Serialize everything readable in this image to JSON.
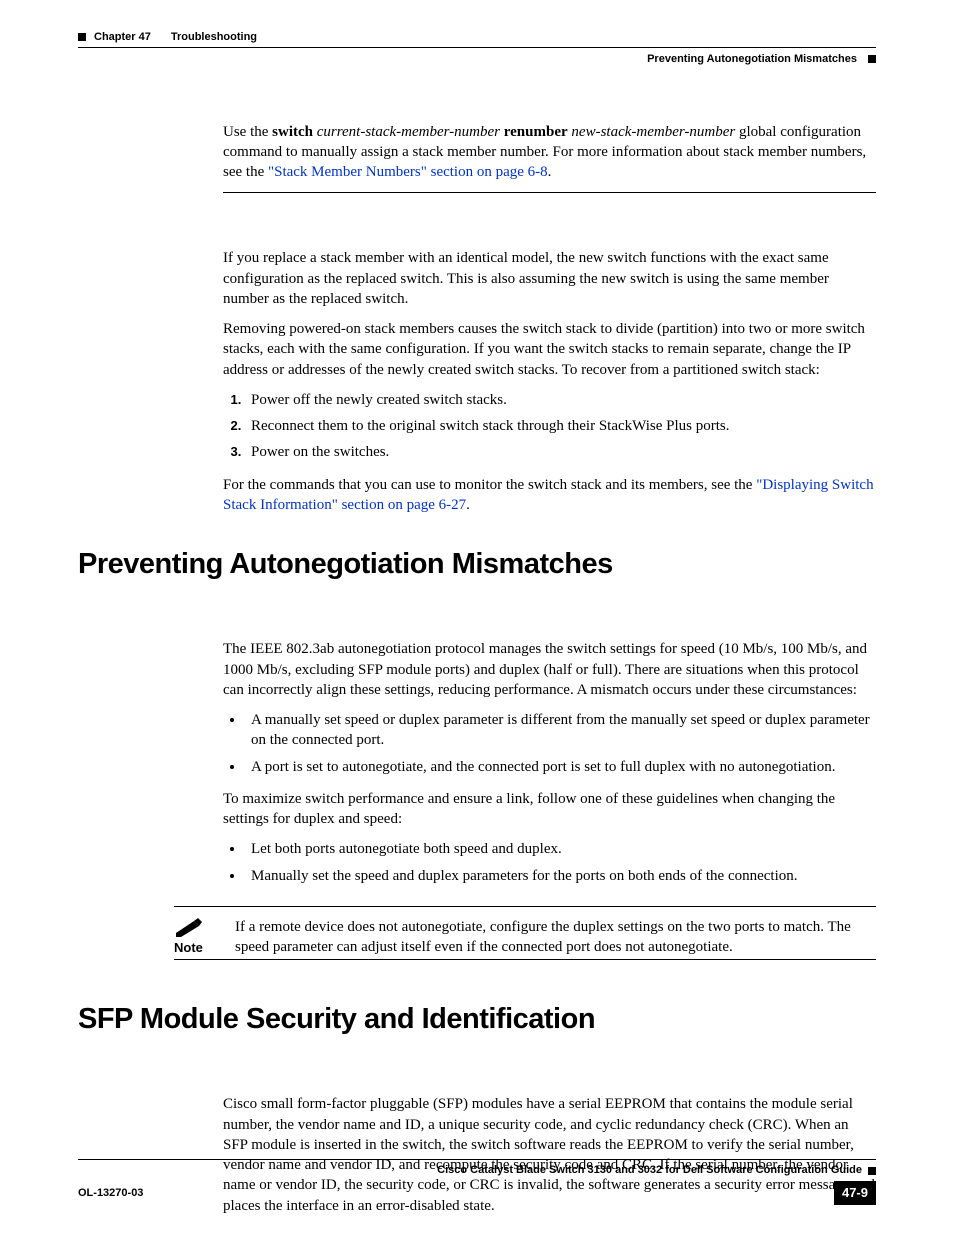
{
  "header": {
    "chapter_label": "Chapter 47",
    "chapter_title": "Troubleshooting",
    "section_right": "Preventing Autonegotiation Mismatches"
  },
  "intro": {
    "prefix": "Use the ",
    "cmd1": "switch",
    "arg1": " current-stack-member-number ",
    "cmd2": "renumber",
    "arg2": " new-stack-member-number",
    "suffix": " global configuration command to manually assign a stack member number. For more information about stack member numbers, see the ",
    "link1": "\"Stack Member Numbers\" section on page 6-8",
    "end": "."
  },
  "para2": "If you replace a stack member with an identical model, the new switch functions with the exact same configuration as the replaced switch. This is also assuming the new switch is using the same member number as the replaced switch.",
  "para3": "Removing powered-on stack members causes the switch stack to divide (partition) into two or more switch stacks, each with the same configuration. If you want the switch stacks to remain separate, change the IP address or addresses of the newly created switch stacks. To recover from a partitioned switch stack:",
  "steps": [
    "Power off the newly created switch stacks.",
    "Reconnect them to the original switch stack through their StackWise Plus ports.",
    "Power on the switches."
  ],
  "para4_prefix": "For the commands that you can use to monitor the switch stack and its members, see the ",
  "para4_link": "\"Displaying Switch Stack Information\" section on page 6-27",
  "para4_end": ".",
  "section1": {
    "title": "Preventing Autonegotiation Mismatches",
    "p1": "The IEEE 802.3ab autonegotiation protocol manages the switch settings for speed (10 Mb/s, 100 Mb/s, and 1000 Mb/s, excluding SFP module ports) and duplex (half or full). There are situations when this protocol can incorrectly align these settings, reducing performance. A mismatch occurs under these circumstances:",
    "bullets1": [
      "A manually set speed or duplex parameter is different from the manually set speed or duplex parameter on the connected port.",
      "A port is set to autonegotiate, and the connected port is set to full duplex with no autonegotiation."
    ],
    "p2": "To maximize switch performance and ensure a link, follow one of these guidelines when changing the settings for duplex and speed:",
    "bullets2": [
      "Let both ports autonegotiate both speed and duplex.",
      "Manually set the speed and duplex parameters for the ports on both ends of the connection."
    ],
    "note_label": "Note",
    "note_text": "If a remote device does not autonegotiate, configure the duplex settings on the two ports to match. The speed parameter can adjust itself even if the connected port does not autonegotiate."
  },
  "section2": {
    "title": "SFP Module Security and Identification",
    "p1": "Cisco small form-factor pluggable (SFP) modules have a serial EEPROM that contains the module serial number, the vendor name and ID, a unique security code, and cyclic redundancy check (CRC). When an SFP module is inserted in the switch, the switch software reads the EEPROM to verify the serial number, vendor name and vendor ID, and recompute the security code and CRC. If the serial number, the vendor name or vendor ID, the security code, or CRC is invalid, the software generates a security error message and places the interface in an error-disabled state."
  },
  "footer": {
    "guide_title": "Cisco Catalyst Blade Switch 3130 and 3032 for Dell Software Configuration Guide",
    "doc_id": "OL-13270-03",
    "page_num": "47-9"
  }
}
